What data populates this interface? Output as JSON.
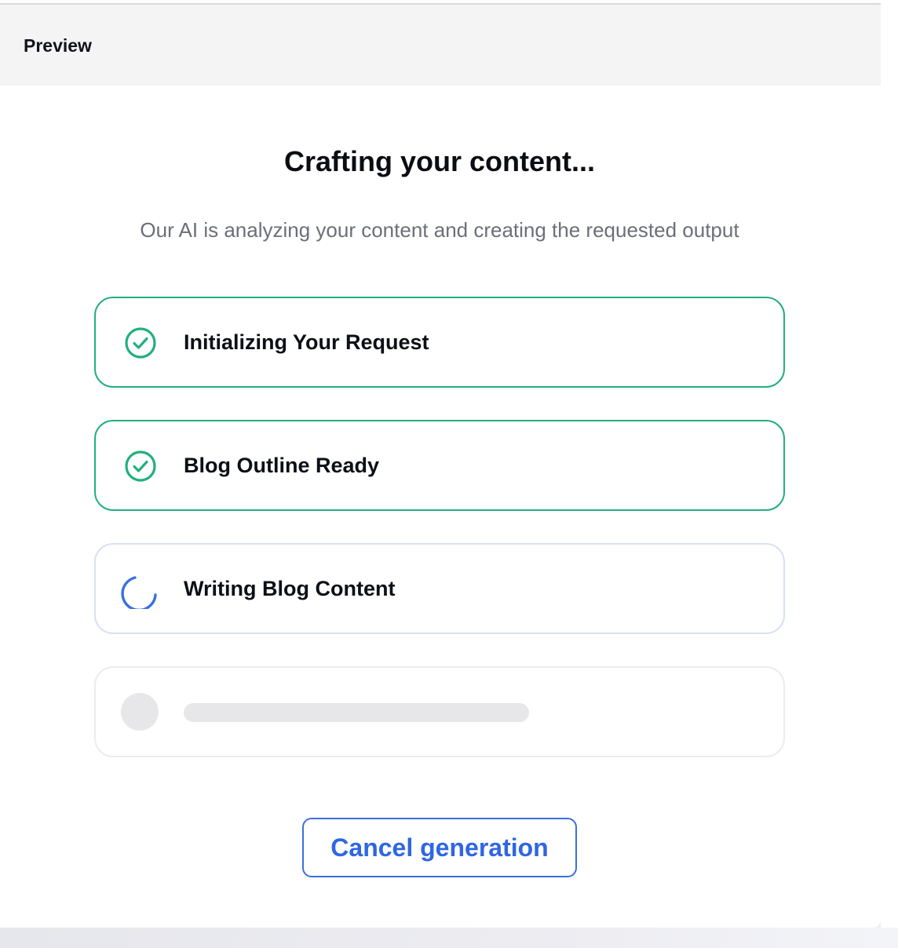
{
  "header": {
    "title": "Preview"
  },
  "main": {
    "title": "Crafting your content...",
    "subtitle": "Our AI is analyzing your content and creating the requested output"
  },
  "steps": [
    {
      "label": "Initializing Your Request",
      "status": "done",
      "icon": "check-circle-icon"
    },
    {
      "label": "Blog Outline Ready",
      "status": "done",
      "icon": "check-circle-icon"
    },
    {
      "label": "Writing Blog Content",
      "status": "in-progress",
      "icon": "spinner-icon"
    },
    {
      "label": "",
      "status": "pending",
      "icon": "placeholder-dot"
    }
  ],
  "actions": {
    "cancel_label": "Cancel generation"
  },
  "colors": {
    "success": "#22b07d",
    "accent": "#2f66e3",
    "muted_text": "#6b6f78",
    "skeleton": "#e7e7ea"
  }
}
